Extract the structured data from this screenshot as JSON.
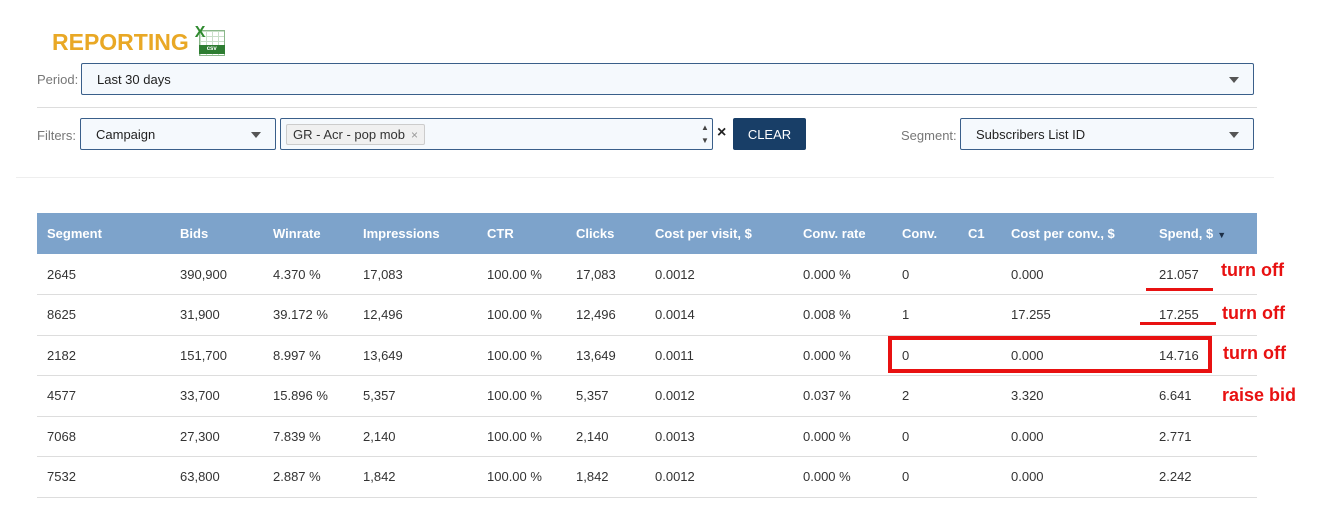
{
  "header": {
    "title": "REPORTING",
    "csv_icon": "excel-csv-icon",
    "csv_x": "X",
    "csv_label": "csv"
  },
  "filters_bar": {
    "period_label": "Period:",
    "period_value": "Last 30 days",
    "filters_label": "Filters:",
    "filter_type_value": "Campaign",
    "filter_tag": "GR - Acr - pop mob",
    "tag_remove": "×",
    "clear_x": "×",
    "clear_button": "CLEAR",
    "segment_label": "Segment:",
    "segment_value": "Subscribers List ID"
  },
  "table": {
    "columns": [
      "Segment",
      "Bids",
      "Winrate",
      "Impressions",
      "CTR",
      "Clicks",
      "Cost per visit, $",
      "Conv. rate",
      "Conv.",
      "C1",
      "Cost per conv., $",
      "Spend, $"
    ],
    "sort_indicator": "▼",
    "rows": [
      [
        "2645",
        "390,900",
        "4.370 %",
        "17,083",
        "100.00 %",
        "17,083",
        "0.0012",
        "0.000 %",
        "0",
        "",
        "0.000",
        "21.057"
      ],
      [
        "8625",
        "31,900",
        "39.172 %",
        "12,496",
        "100.00 %",
        "12,496",
        "0.0014",
        "0.008 %",
        "1",
        "",
        "17.255",
        "17.255"
      ],
      [
        "2182",
        "151,700",
        "8.997 %",
        "13,649",
        "100.00 %",
        "13,649",
        "0.0011",
        "0.000 %",
        "0",
        "",
        "0.000",
        "14.716"
      ],
      [
        "4577",
        "33,700",
        "15.896 %",
        "5,357",
        "100.00 %",
        "5,357",
        "0.0012",
        "0.037 %",
        "2",
        "",
        "3.320",
        "6.641"
      ],
      [
        "7068",
        "27,300",
        "7.839 %",
        "2,140",
        "100.00 %",
        "2,140",
        "0.0013",
        "0.000 %",
        "0",
        "",
        "0.000",
        "2.771"
      ],
      [
        "7532",
        "63,800",
        "2.887 %",
        "1,842",
        "100.00 %",
        "1,842",
        "0.0012",
        "0.000 %",
        "0",
        "",
        "0.000",
        "2.242"
      ]
    ]
  },
  "annotations": [
    "turn off",
    "turn off",
    "turn off",
    "raise bid"
  ],
  "colors": {
    "title": "#e9a825",
    "header_bg": "#7da3cb",
    "button": "#183e67",
    "link": "#2a8ab4",
    "annotation": "#e81111"
  }
}
